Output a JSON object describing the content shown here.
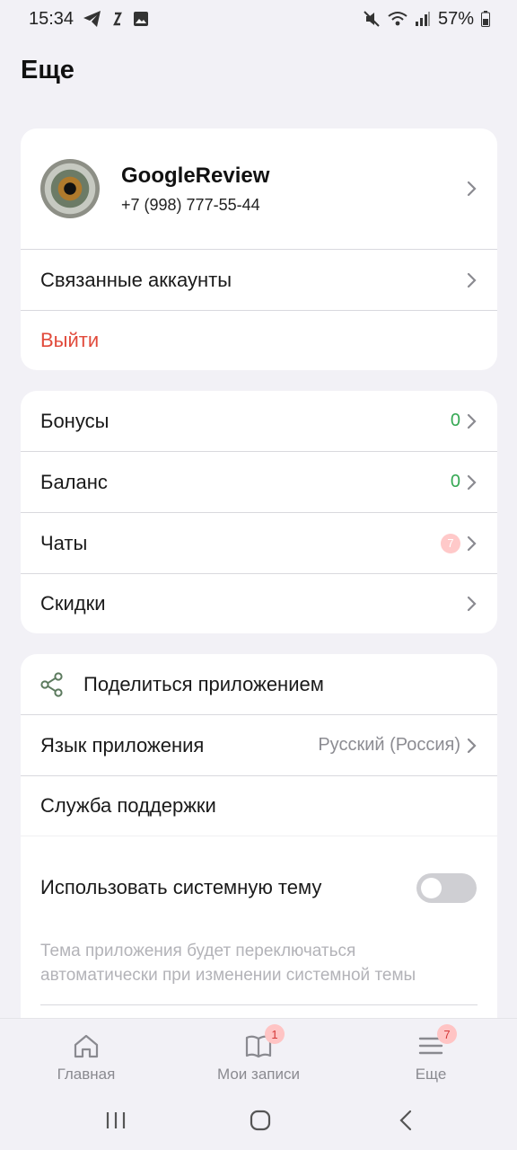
{
  "status_bar": {
    "time": "15:34",
    "battery": "57%"
  },
  "page": {
    "title": "Еще"
  },
  "profile": {
    "name": "GoogleReview",
    "phone": "+7 (998) 777-55-44",
    "linked_accounts_label": "Связанные аккаунты",
    "logout_label": "Выйти"
  },
  "menu": {
    "bonuses": {
      "label": "Бонусы",
      "value": "0"
    },
    "balance": {
      "label": "Баланс",
      "value": "0"
    },
    "chats": {
      "label": "Чаты",
      "badge": "7"
    },
    "discounts": {
      "label": "Скидки"
    }
  },
  "settings": {
    "share_label": "Поделиться приложением",
    "language_label": "Язык приложения",
    "language_value": "Русский (Россия)",
    "support_label": "Служба поддержки",
    "system_theme_label": "Использовать системную тему",
    "system_theme_on": false,
    "system_theme_hint": "Тема приложения будет переключаться автоматически при изменении системной темы"
  },
  "bottom_nav": {
    "items": [
      {
        "label": "Главная",
        "icon": "home-icon"
      },
      {
        "label": "Мои записи",
        "icon": "book-icon",
        "badge": "1"
      },
      {
        "label": "Еще",
        "icon": "menu-icon",
        "badge": "7"
      }
    ]
  },
  "colors": {
    "accent_red": "#e14a3b",
    "value_green": "#35a853",
    "background": "#f2f1f6"
  }
}
